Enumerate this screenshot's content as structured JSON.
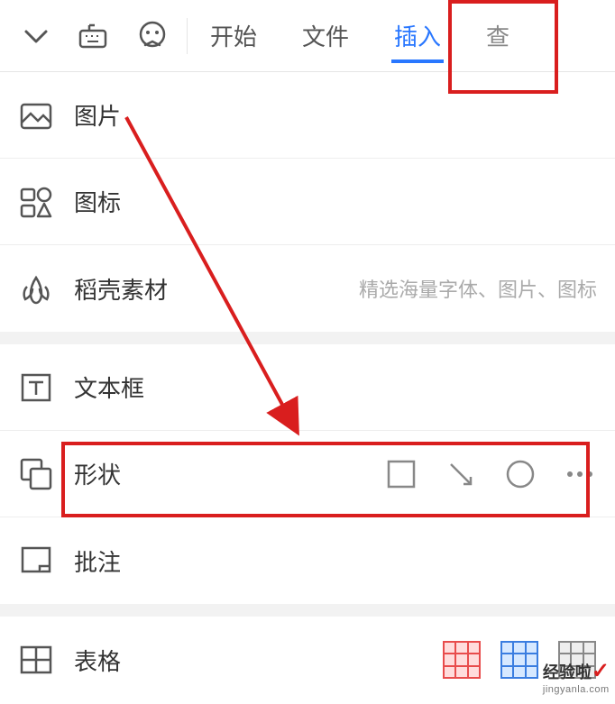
{
  "toolbar": {
    "tabs": {
      "start": "开始",
      "file": "文件",
      "insert": "插入",
      "view": "查"
    }
  },
  "menu": {
    "image": "图片",
    "icons": "图标",
    "material": "稻壳素材",
    "material_hint": "精选海量字体、图片、图标",
    "textbox": "文本框",
    "shape": "形状",
    "comment": "批注",
    "table": "表格"
  },
  "watermark": {
    "brand": "经验啦",
    "url": "jingyanla.com"
  }
}
